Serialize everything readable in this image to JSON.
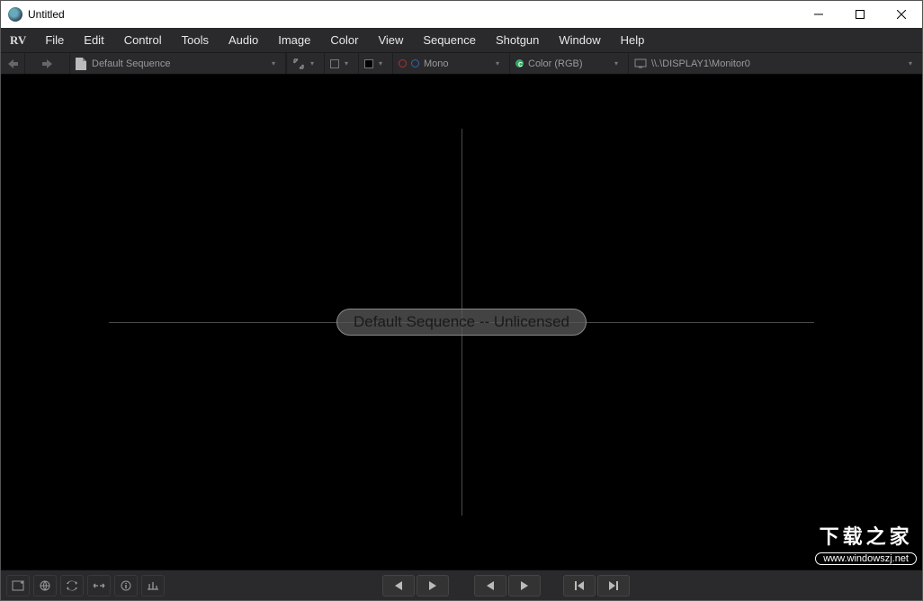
{
  "titlebar": {
    "title": "Untitled"
  },
  "menubar": {
    "logo": "RV",
    "items": [
      "File",
      "Edit",
      "Control",
      "Tools",
      "Audio",
      "Image",
      "Color",
      "View",
      "Sequence",
      "Shotgun",
      "Window",
      "Help"
    ]
  },
  "toolbar": {
    "sequence_label": "Default Sequence",
    "stereo_label": "Mono",
    "color_label": "Color (RGB)",
    "display_label": "\\\\.\\DISPLAY1\\Monitor0"
  },
  "viewport": {
    "overlay_text": "Default Sequence -- Unlicensed"
  },
  "watermark": {
    "line1": "下载之家",
    "line2": "www.windowszj.net"
  }
}
